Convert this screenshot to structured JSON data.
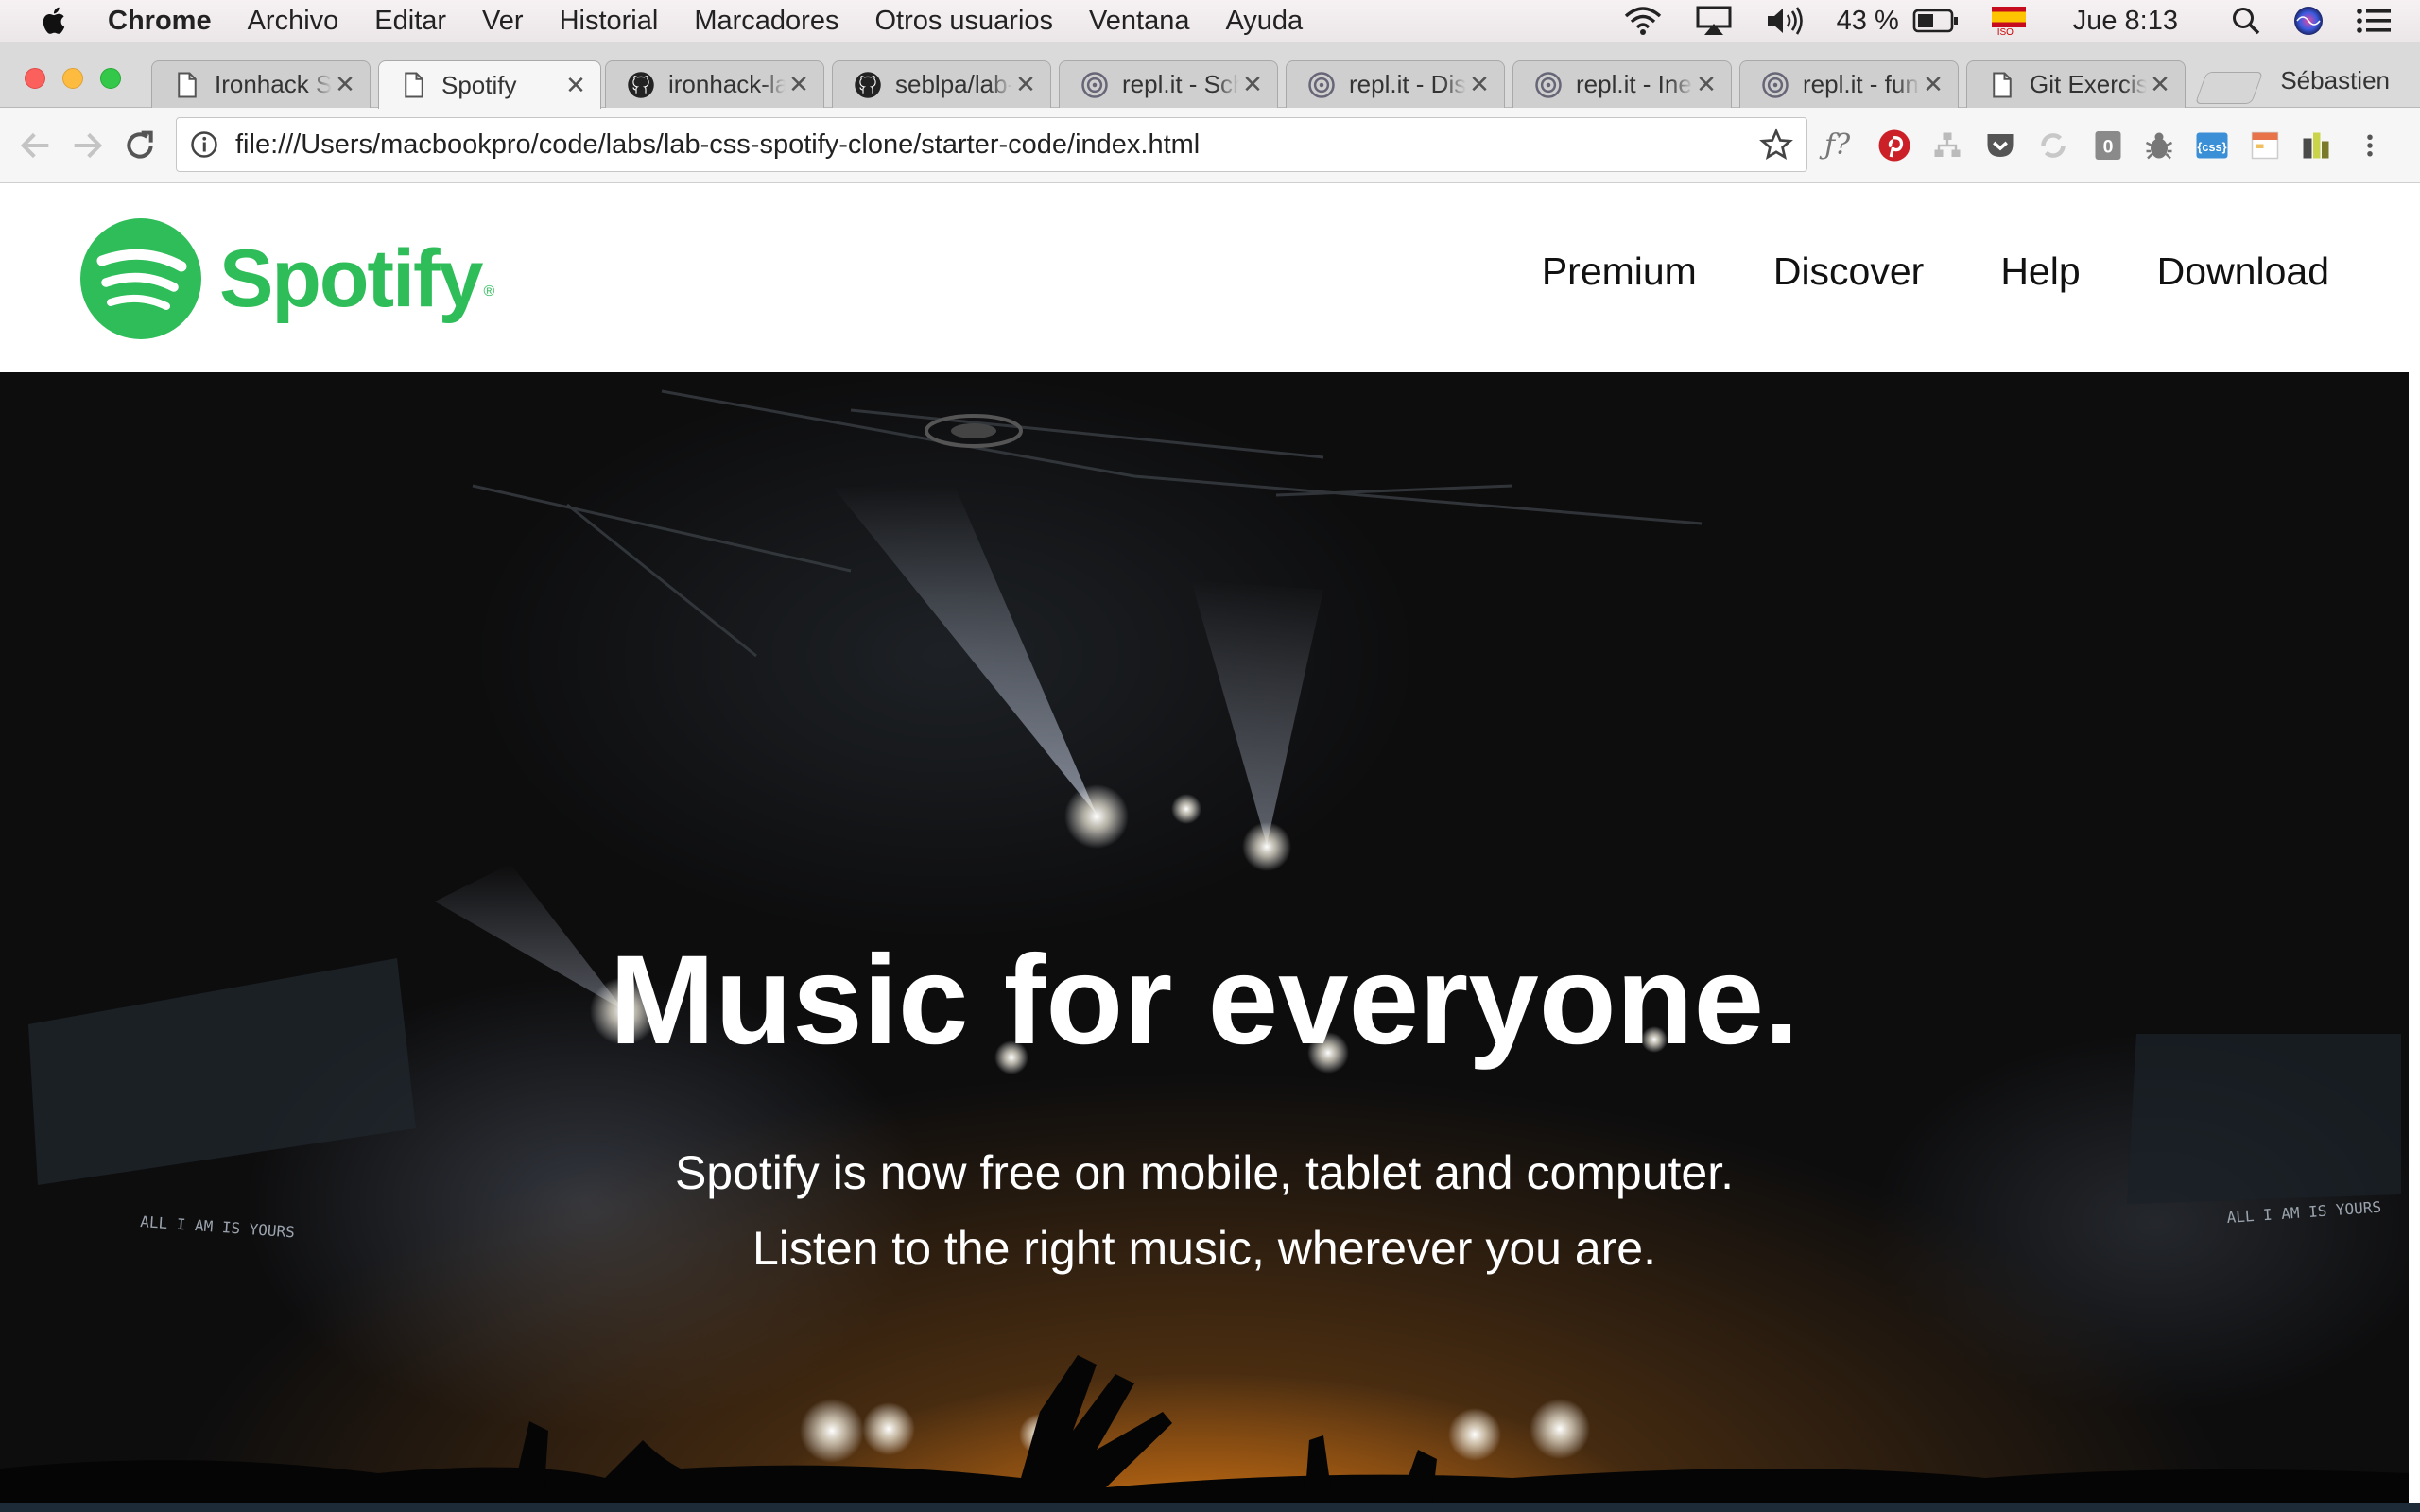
{
  "menubar": {
    "app": "Chrome",
    "items": [
      "Archivo",
      "Editar",
      "Ver",
      "Historial",
      "Marcadores",
      "Otros usuarios",
      "Ventana",
      "Ayuda"
    ],
    "battery": "43 %",
    "clock": "Jue 8:13",
    "input_source": "ISO"
  },
  "tabs": [
    {
      "title": "Ironhack Students",
      "favicon": "page-icon",
      "active": false
    },
    {
      "title": "Spotify",
      "favicon": "page-icon",
      "active": true
    },
    {
      "title": "ironhack-labs",
      "favicon": "github-icon",
      "active": false
    },
    {
      "title": "seblpa/lab-css",
      "favicon": "github-icon",
      "active": false
    },
    {
      "title": "repl.it - Schedule",
      "favicon": "replit-icon",
      "active": false
    },
    {
      "title": "repl.it - Discount",
      "favicon": "replit-icon",
      "active": false
    },
    {
      "title": "repl.it - Inex",
      "favicon": "replit-icon",
      "active": false
    },
    {
      "title": "repl.it - functions",
      "favicon": "replit-icon",
      "active": false
    },
    {
      "title": "Git Exercise",
      "favicon": "page-icon",
      "active": false
    }
  ],
  "profile": "Sébastien",
  "address_bar": {
    "url": "file:///Users/macbookpro/code/labs/lab-css-spotify-clone/starter-code/index.html"
  },
  "site": {
    "brand": "Spotify",
    "brand_color": "#2ebd59",
    "nav": [
      "Premium",
      "Discover",
      "Help",
      "Download"
    ],
    "hero_title": "Music for everyone.",
    "hero_line1": "Spotify is now free on mobile, tablet and computer.",
    "hero_line2": "Listen to the right music, wherever you are.",
    "stage_text": "ALL I AM IS YOURS"
  }
}
